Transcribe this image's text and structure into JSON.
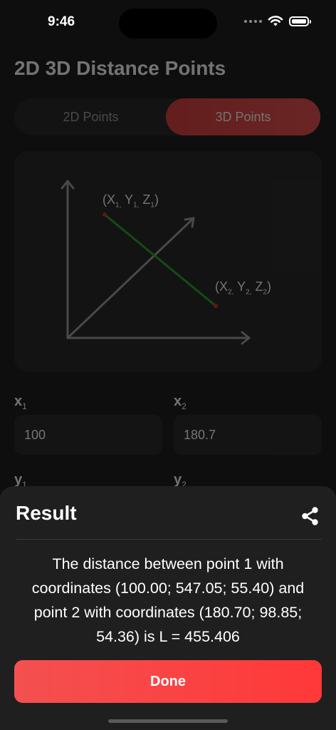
{
  "status_bar": {
    "time": "9:46",
    "wifi_icon": "wifi-icon",
    "battery_icon": "battery-icon"
  },
  "page": {
    "title": "2D 3D Distance Points"
  },
  "segmented": {
    "tabs": [
      {
        "label": "2D Points",
        "active": false
      },
      {
        "label": "3D Points",
        "active": true
      }
    ]
  },
  "diagram": {
    "point1": {
      "x": "X",
      "x_sub": "1,",
      "y": "Y",
      "y_sub": "1,",
      "z": "Z",
      "z_sub": "1"
    },
    "point2": {
      "x": "X",
      "x_sub": "2,",
      "y": "Y",
      "y_sub": "2,",
      "z": "Z",
      "z_sub": "2"
    },
    "line_color": "#1aa11a",
    "point_color": "#d21f1f"
  },
  "fields": {
    "x1": {
      "letter": "x",
      "sub": "1",
      "value": "100"
    },
    "x2": {
      "letter": "x",
      "sub": "2",
      "value": "180.7"
    },
    "y1": {
      "letter": "y",
      "sub": "1"
    },
    "y2": {
      "letter": "y",
      "sub": "2"
    }
  },
  "result_sheet": {
    "title": "Result",
    "share_icon": "share-icon",
    "text": "The distance between point 1 with coordinates (100.00; 547.05; 55.40) and point 2 with coordinates (180.70; 98.85; 54.36) is L = 455.406",
    "done_label": "Done",
    "accent_color": "#ff3838"
  }
}
